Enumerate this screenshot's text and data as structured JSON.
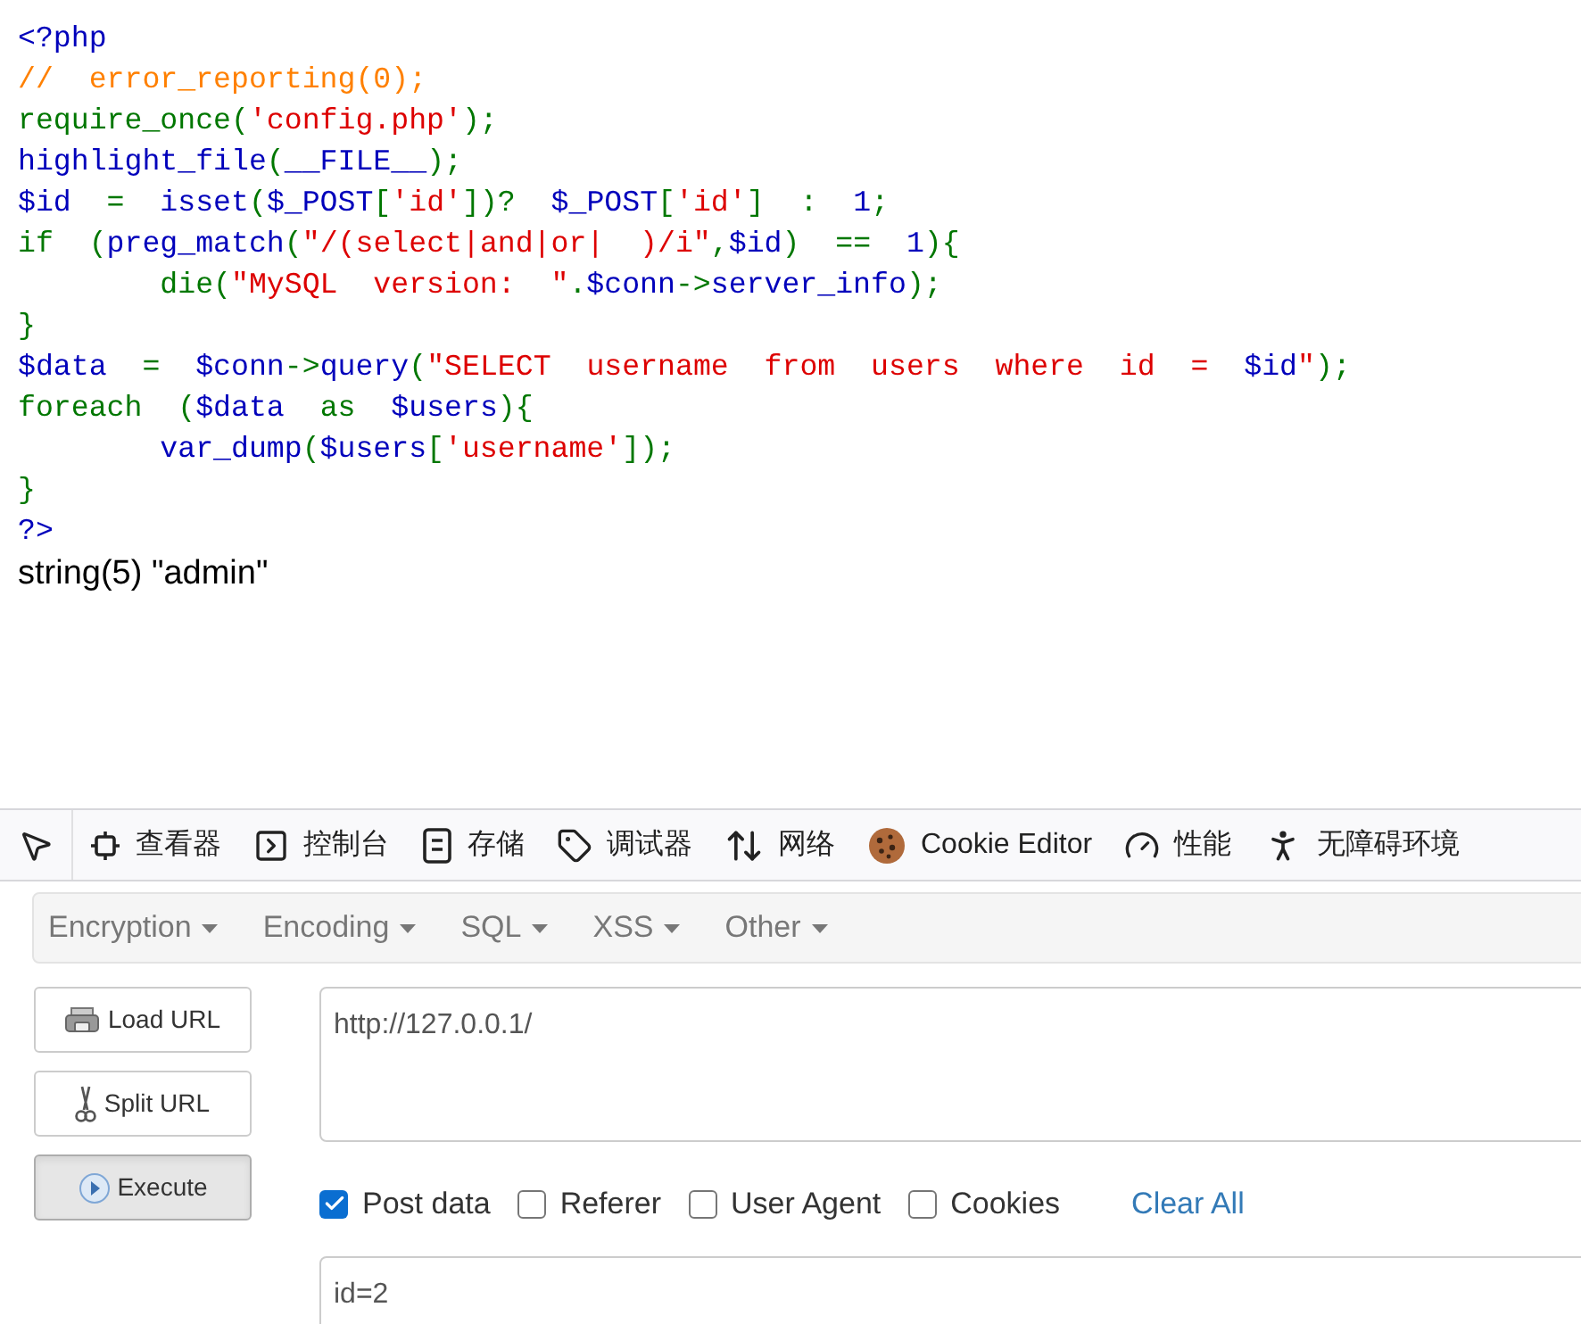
{
  "source_code": {
    "lines": [
      [
        {
          "text": "<?php",
          "color": "#0000bb"
        }
      ],
      [
        {
          "text": "//  error_reporting(0);",
          "color": "#ff8000"
        }
      ],
      [
        {
          "text": "require_once(",
          "color": "#007700"
        },
        {
          "text": "'config.php'",
          "color": "#dd0000"
        },
        {
          "text": ");",
          "color": "#007700"
        }
      ],
      [
        {
          "text": "highlight_file",
          "color": "#0000bb"
        },
        {
          "text": "(",
          "color": "#007700"
        },
        {
          "text": "__FILE__",
          "color": "#0000bb"
        },
        {
          "text": ");",
          "color": "#007700"
        }
      ],
      [
        {
          "text": "$id  ",
          "color": "#0000bb"
        },
        {
          "text": "=  ",
          "color": "#007700"
        },
        {
          "text": "isset",
          "color": "#0000bb"
        },
        {
          "text": "(",
          "color": "#007700"
        },
        {
          "text": "$_POST",
          "color": "#0000bb"
        },
        {
          "text": "[",
          "color": "#007700"
        },
        {
          "text": "'id'",
          "color": "#dd0000"
        },
        {
          "text": "])?  ",
          "color": "#007700"
        },
        {
          "text": "$_POST",
          "color": "#0000bb"
        },
        {
          "text": "[",
          "color": "#007700"
        },
        {
          "text": "'id'",
          "color": "#dd0000"
        },
        {
          "text": "]  :  ",
          "color": "#007700"
        },
        {
          "text": "1",
          "color": "#0000bb"
        },
        {
          "text": ";",
          "color": "#007700"
        }
      ],
      [
        {
          "text": "if  (",
          "color": "#007700"
        },
        {
          "text": "preg_match",
          "color": "#0000bb"
        },
        {
          "text": "(",
          "color": "#007700"
        },
        {
          "text": "\"/(select|and|or|  )/i\"",
          "color": "#dd0000"
        },
        {
          "text": ",",
          "color": "#007700"
        },
        {
          "text": "$id",
          "color": "#0000bb"
        },
        {
          "text": ")  ==  ",
          "color": "#007700"
        },
        {
          "text": "1",
          "color": "#0000bb"
        },
        {
          "text": "){",
          "color": "#007700"
        }
      ],
      [
        {
          "text": "        die(",
          "color": "#007700"
        },
        {
          "text": "\"MySQL  version:  \"",
          "color": "#dd0000"
        },
        {
          "text": ".",
          "color": "#007700"
        },
        {
          "text": "$conn",
          "color": "#0000bb"
        },
        {
          "text": "->",
          "color": "#007700"
        },
        {
          "text": "server_info",
          "color": "#0000bb"
        },
        {
          "text": ");",
          "color": "#007700"
        }
      ],
      [
        {
          "text": "}",
          "color": "#007700"
        }
      ],
      [
        {
          "text": "$data  ",
          "color": "#0000bb"
        },
        {
          "text": "=  ",
          "color": "#007700"
        },
        {
          "text": "$conn",
          "color": "#0000bb"
        },
        {
          "text": "->",
          "color": "#007700"
        },
        {
          "text": "query",
          "color": "#0000bb"
        },
        {
          "text": "(",
          "color": "#007700"
        },
        {
          "text": "\"SELECT  username  from  users  where  id  =  ",
          "color": "#dd0000"
        },
        {
          "text": "$id",
          "color": "#0000bb"
        },
        {
          "text": "\"",
          "color": "#dd0000"
        },
        {
          "text": ");",
          "color": "#007700"
        }
      ],
      [
        {
          "text": "foreach  (",
          "color": "#007700"
        },
        {
          "text": "$data  ",
          "color": "#0000bb"
        },
        {
          "text": "as  ",
          "color": "#007700"
        },
        {
          "text": "$users",
          "color": "#0000bb"
        },
        {
          "text": "){",
          "color": "#007700"
        }
      ],
      [
        {
          "text": "        var_dump",
          "color": "#0000bb"
        },
        {
          "text": "(",
          "color": "#007700"
        },
        {
          "text": "$users",
          "color": "#0000bb"
        },
        {
          "text": "[",
          "color": "#007700"
        },
        {
          "text": "'username'",
          "color": "#dd0000"
        },
        {
          "text": "]);",
          "color": "#007700"
        }
      ],
      [
        {
          "text": "}",
          "color": "#007700"
        }
      ],
      [
        {
          "text": "?>",
          "color": "#0000bb"
        }
      ]
    ]
  },
  "output": "string(5) \"admin\"",
  "devtools_tabs": [
    {
      "label": "查看器"
    },
    {
      "label": "控制台"
    },
    {
      "label": "存储"
    },
    {
      "label": "调试器"
    },
    {
      "label": "网络"
    },
    {
      "label": "Cookie Editor"
    },
    {
      "label": "性能"
    },
    {
      "label": "无障碍环境"
    }
  ],
  "hackbar": {
    "menus": [
      "Encryption",
      "Encoding",
      "SQL",
      "XSS",
      "Other"
    ],
    "buttons": [
      {
        "label": "Load URL",
        "highlighted": false
      },
      {
        "label": "Split URL",
        "highlighted": false
      },
      {
        "label": "Execute",
        "highlighted": true
      }
    ],
    "url": "http://127.0.0.1/",
    "options": [
      {
        "label": "Post data",
        "checked": true
      },
      {
        "label": "Referer",
        "checked": false
      },
      {
        "label": "User Agent",
        "checked": false
      },
      {
        "label": "Cookies",
        "checked": false
      }
    ],
    "clear_all": "Clear All",
    "post_data": "id=2"
  }
}
